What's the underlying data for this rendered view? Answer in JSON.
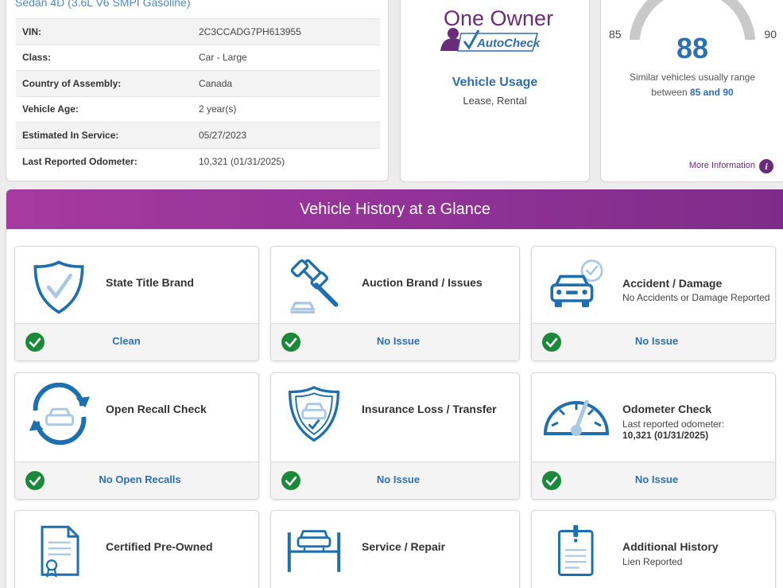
{
  "vehicle": {
    "subtitle": "Sedan 4D (3.6L V6 SMPI Gasoline)",
    "specs": [
      {
        "label": "VIN:",
        "value": "2C3CCADG7PH613955"
      },
      {
        "label": "Class:",
        "value": "Car - Large"
      },
      {
        "label": "Country of Assembly:",
        "value": "Canada"
      },
      {
        "label": "Vehicle Age:",
        "value": "2 year(s)"
      },
      {
        "label": "Estimated In Service:",
        "value": "05/27/2023"
      },
      {
        "label": "Last Reported Odometer:",
        "value": "10,321 (01/31/2025)"
      }
    ]
  },
  "owner": {
    "logo_title": "One Owner",
    "logo_brand": "AutoCheck",
    "usage_title": "Vehicle Usage",
    "usage_value": "Lease, Rental"
  },
  "score": {
    "min": "85",
    "max": "90",
    "value": "88",
    "note_prefix": "Similar vehicles usually range between",
    "note_range": "85 and 90",
    "gauge_level": 0.6,
    "more_info": "More Information",
    "info_glyph": "i"
  },
  "glance": {
    "title": "Vehicle History at a Glance",
    "tiles": [
      {
        "title": "State Title Brand",
        "sub": "",
        "sub2": "",
        "status": "Clean",
        "icon": "shield-check-icon"
      },
      {
        "title": "Auction Brand / Issues",
        "sub": "",
        "sub2": "",
        "status": "No Issue",
        "icon": "gavel-icon"
      },
      {
        "title": "Accident / Damage",
        "sub": "No Accidents or Damage Reported",
        "sub2": "",
        "status": "No Issue",
        "icon": "car-check-icon"
      },
      {
        "title": "Open Recall Check",
        "sub": "",
        "sub2": "",
        "status": "No Open Recalls",
        "icon": "recall-cycle-icon"
      },
      {
        "title": "Insurance Loss / Transfer",
        "sub": "",
        "sub2": "",
        "status": "No Issue",
        "icon": "insurance-shield-icon"
      },
      {
        "title": "Odometer Check",
        "sub": "Last reported odometer:",
        "sub2": "10,321 (01/31/2025)",
        "status": "No Issue",
        "icon": "odometer-icon"
      },
      {
        "title": "Certified Pre-Owned",
        "sub": "",
        "sub2": "",
        "status": "",
        "icon": "certificate-icon"
      },
      {
        "title": "Service / Repair",
        "sub": "",
        "sub2": "",
        "status": "",
        "icon": "car-lift-icon"
      },
      {
        "title": "Additional History",
        "sub": "Lien Reported",
        "sub2": "",
        "status": "",
        "icon": "clipboard-alert-icon"
      }
    ]
  },
  "colors": {
    "accent_blue": "#2d6fb2",
    "purple": "#6b2a7a",
    "check_green": "#1a8a3a"
  }
}
